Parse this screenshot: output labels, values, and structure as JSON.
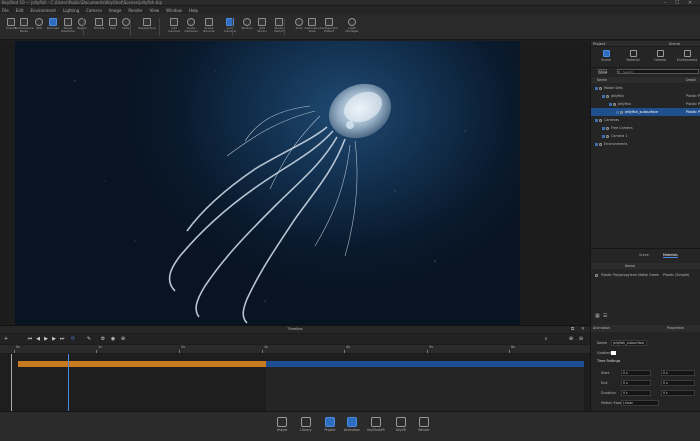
{
  "window": {
    "title": "KeyShot 10 — jellyfish - C:\\Users\\Public\\Documents\\KeyShot\\Scenes\\jellyfish.bip",
    "controls": [
      "–",
      "☐",
      "✕"
    ]
  },
  "menubar": [
    "File",
    "Edit",
    "Environment",
    "Lighting",
    "Camera",
    "Image",
    "Render",
    "View",
    "Window",
    "Help"
  ],
  "toolbar": [
    {
      "label": "Import",
      "icon": "import-icon"
    },
    {
      "label": "Performance\nMode",
      "icon": "performance-icon"
    },
    {
      "label": "CPU",
      "icon": "cpu-icon"
    },
    {
      "label": "Denoise",
      "icon": "denoise-icon",
      "active": true
    },
    {
      "label": "Pause\nRealtime",
      "icon": "pause-icon"
    },
    {
      "label": "Region",
      "icon": "region-icon"
    },
    {
      "label": "Tumble",
      "icon": "tumble-icon"
    },
    {
      "label": "Pan",
      "icon": "pan-icon"
    },
    {
      "label": "Dolly",
      "icon": "dolly-icon"
    },
    {
      "label": "Perspective",
      "icon": "perspective-icon"
    },
    {
      "label": "Add\nCamera",
      "icon": "add-camera-icon"
    },
    {
      "label": "Cycle\nCameras",
      "icon": "cycle-cameras-icon"
    },
    {
      "label": "Scene\nBounds",
      "icon": "scene-bounds-icon"
    },
    {
      "label": "Lock\nCamera",
      "icon": "lock-camera-icon",
      "active": true
    },
    {
      "label": "Studios",
      "icon": "studios-icon"
    },
    {
      "label": "Add\nStudio",
      "icon": "add-studio-icon"
    },
    {
      "label": "Studio\nSwitch",
      "icon": "studio-switch-icon"
    },
    {
      "label": "Tools",
      "icon": "tools-icon"
    },
    {
      "label": "Geometry\nView",
      "icon": "geometry-view-icon"
    },
    {
      "label": "Configurator\nWizard",
      "icon": "configurator-icon"
    },
    {
      "label": "Light\nManager",
      "icon": "light-manager-icon"
    }
  ],
  "project_panel": {
    "title": "Project",
    "section": "Scene",
    "tabs": [
      "Scene",
      "Material",
      "Camera",
      "Environment"
    ],
    "search_placeholder": "Search",
    "filter_label": "Show",
    "columns": [
      "Name",
      "Detail"
    ],
    "tree": [
      {
        "label": "Model Sets",
        "indent": 0
      },
      {
        "label": "jellyfish",
        "detail": "Plastic Poly",
        "indent": 1
      },
      {
        "label": "jellyfish",
        "detail": "Plastic Poly",
        "indent": 2
      },
      {
        "label": "jellyfish_subsurface",
        "detail": "Plastic Poly",
        "indent": 3,
        "selected": true
      },
      {
        "label": "Cameras",
        "indent": 0
      },
      {
        "label": "Free Camera",
        "indent": 1
      },
      {
        "label": "Camera 1",
        "indent": 1
      },
      {
        "label": "Environments",
        "indent": 0
      }
    ],
    "subtabs": [
      "Scene",
      "Materials"
    ],
    "mat_header": "Name",
    "materials": [
      "Plastic Polypropylene Matte Green",
      "Plastic (Simple)"
    ]
  },
  "timeline": {
    "title": "Timeline",
    "ticks": [
      "0s",
      "1s",
      "2s",
      "3s",
      "4s",
      "5s",
      "6s"
    ]
  },
  "animation_panel": {
    "header_left": "Animation",
    "header_right": "Properties",
    "name_label": "Name",
    "name_value": "jellyfish_subsurface",
    "section_label": "Time Settings",
    "color_label": "Gradient",
    "rows": [
      {
        "label": "Start",
        "a": "0 s",
        "b": "0 s"
      },
      {
        "label": "End",
        "a": "0 s",
        "b": "0 s"
      },
      {
        "label": "Duration",
        "a": "0 s",
        "b": "0 s"
      },
      {
        "label": "Motion Ease",
        "a": "Linear",
        "b": ""
      }
    ]
  },
  "bottombar": [
    {
      "label": "Import",
      "icon": "import-icon"
    },
    {
      "label": "Library",
      "icon": "library-icon"
    },
    {
      "label": "Project",
      "icon": "project-icon",
      "active": true
    },
    {
      "label": "Animation",
      "icon": "animation-icon",
      "active": true
    },
    {
      "label": "KeyShotXR",
      "icon": "keyshotxr-icon"
    },
    {
      "label": "KeyVR",
      "icon": "keyvr-icon"
    },
    {
      "label": "Render",
      "icon": "render-icon"
    }
  ],
  "colors": {
    "accent": "#2f6dc0",
    "timeline_orange": "#c87a1e",
    "timeline_blue": "#1c4f93"
  }
}
